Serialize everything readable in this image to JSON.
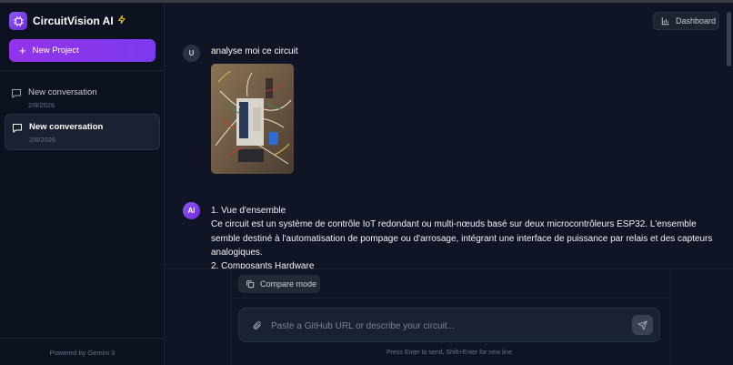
{
  "app": {
    "title": "CircuitVision AI",
    "accent": "#8b5cf6",
    "bolt_color": "#facc15"
  },
  "sidebar": {
    "new_project_label": "New Project",
    "conversations": [
      {
        "title": "New conversation",
        "date": "2/8/2026",
        "active": false
      },
      {
        "title": "New conversation",
        "date": "2/8/2026",
        "active": true
      }
    ],
    "footer": "Powered by Gemini 3"
  },
  "header": {
    "dashboard_label": "Dashboard"
  },
  "chat": {
    "user_avatar": "U",
    "user_message": "analyse moi ce circuit",
    "ai_avatar": "AI",
    "ai_lines": [
      "1. Vue d'ensemble",
      "Ce circuit est un système de contrôle IoT redondant ou multi-nœuds basé sur deux microcontrôleurs ESP32. L'ensemble semble destiné à l'automatisation de pompage ou d'arrosage, intégrant une interface de puissance par relais et des capteurs analogiques.",
      "2. Composants Hardware"
    ]
  },
  "composer": {
    "compare_label": "Compare mode",
    "placeholder": "Paste a GitHub URL or describe your circuit...",
    "hint": "Press Enter to send, Shift+Enter for new line"
  }
}
